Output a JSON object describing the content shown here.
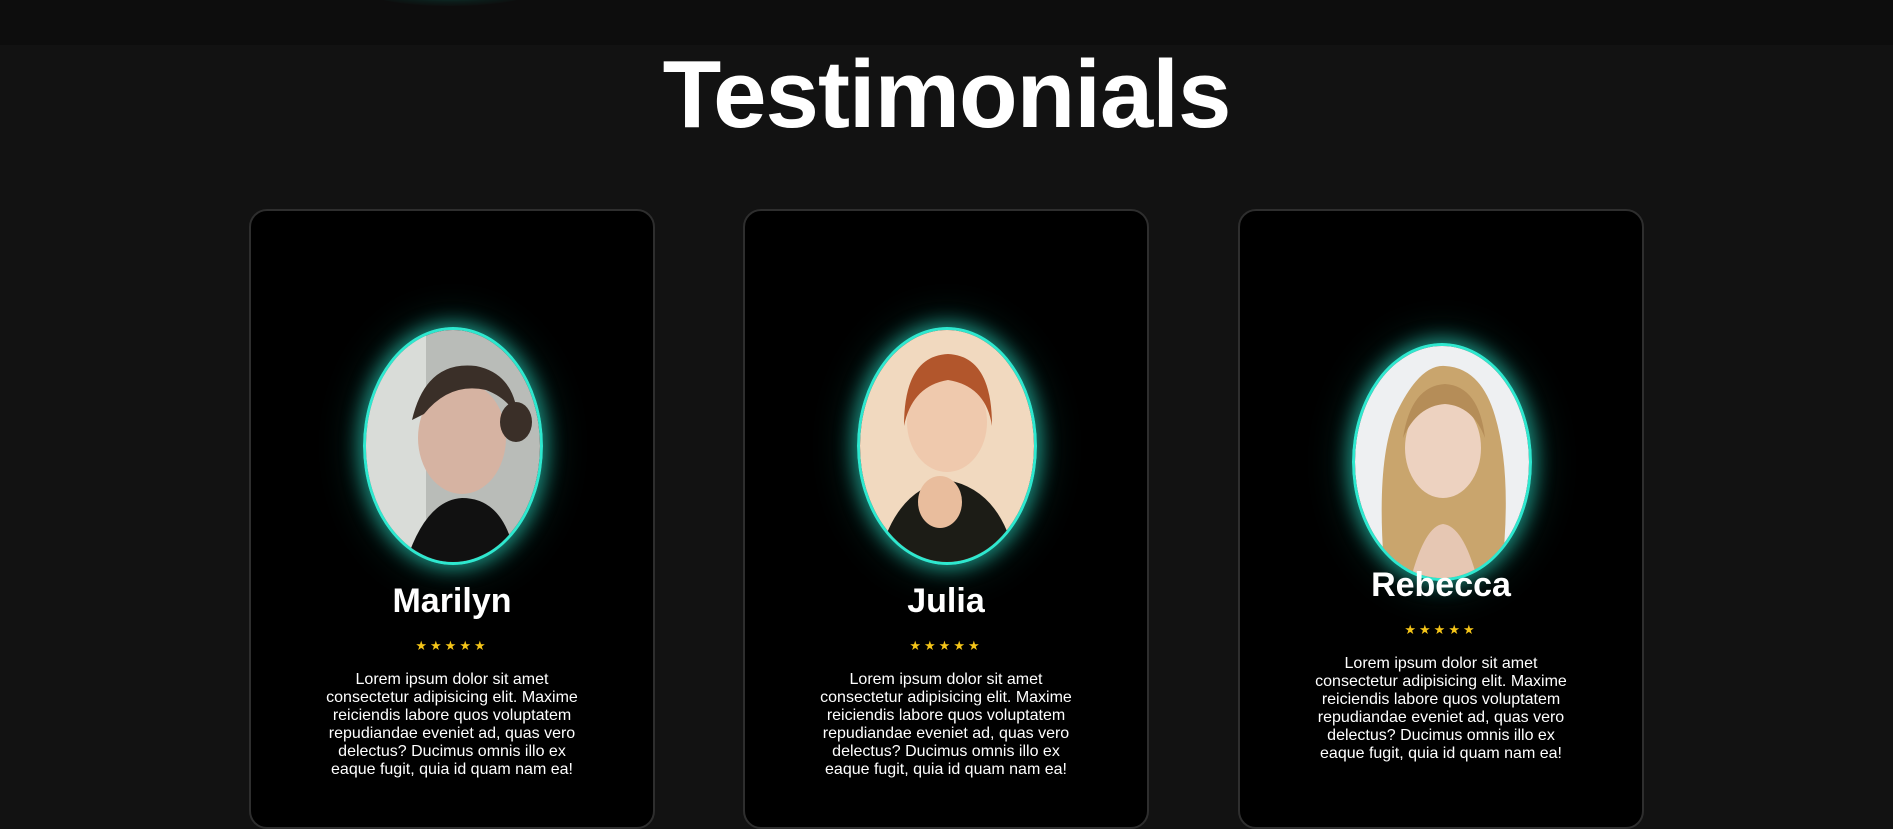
{
  "page": {
    "title": "Testimonials"
  },
  "colors": {
    "background": "#121212",
    "card_background": "#000000",
    "card_border": "#2e2e2e",
    "accent_glow": "#2ee8cf",
    "star": "#f5c518"
  },
  "testimonials": [
    {
      "name": "Marilyn",
      "rating": 5,
      "stars": "★★★★★",
      "quote": "Lorem ipsum dolor sit amet consectetur adipisicing elit. Maxime reiciendis labore quos voluptatem repudiandae eveniet ad, quas vero delectus? Ducimus omnis illo ex eaque fugit, quia id quam nam ea!",
      "avatar_icon": "portrait-photo"
    },
    {
      "name": "Julia",
      "rating": 5,
      "stars": "★★★★★",
      "quote": "Lorem ipsum dolor sit amet consectetur adipisicing elit. Maxime reiciendis labore quos voluptatem repudiandae eveniet ad, quas vero delectus? Ducimus omnis illo ex eaque fugit, quia id quam nam ea!",
      "avatar_icon": "portrait-photo"
    },
    {
      "name": "Rebecca",
      "rating": 5,
      "stars": "★★★★★",
      "quote": "Lorem ipsum dolor sit amet consectetur adipisicing elit. Maxime reiciendis labore quos voluptatem repudiandae eveniet ad, quas vero delectus? Ducimus omnis illo ex eaque fugit, quia id quam nam ea!",
      "avatar_icon": "portrait-photo"
    }
  ]
}
